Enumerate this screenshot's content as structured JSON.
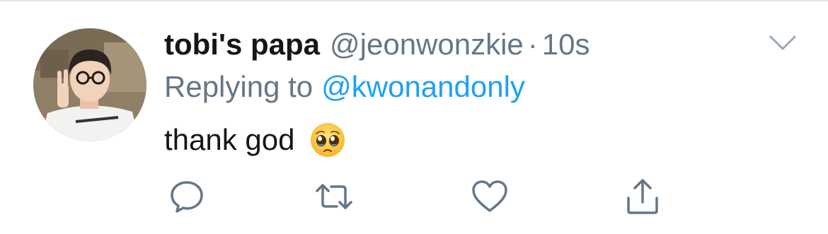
{
  "tweet": {
    "display_name": "tobi's papa",
    "handle": "@jeonwonzkie",
    "separator": "·",
    "timestamp": "10s",
    "replying_prefix": "Replying to",
    "replying_to": "@kwonandonly",
    "text": "thank god",
    "emoji": "pleading-face-emoji"
  },
  "actions": {
    "reply_icon": "reply-icon",
    "retweet_icon": "retweet-icon",
    "like_icon": "heart-icon",
    "share_icon": "share-icon"
  },
  "colors": {
    "name": "#14171a",
    "secondary": "#657786",
    "link": "#1da1f2",
    "border": "#e1e8ed",
    "icon": "#657786"
  }
}
